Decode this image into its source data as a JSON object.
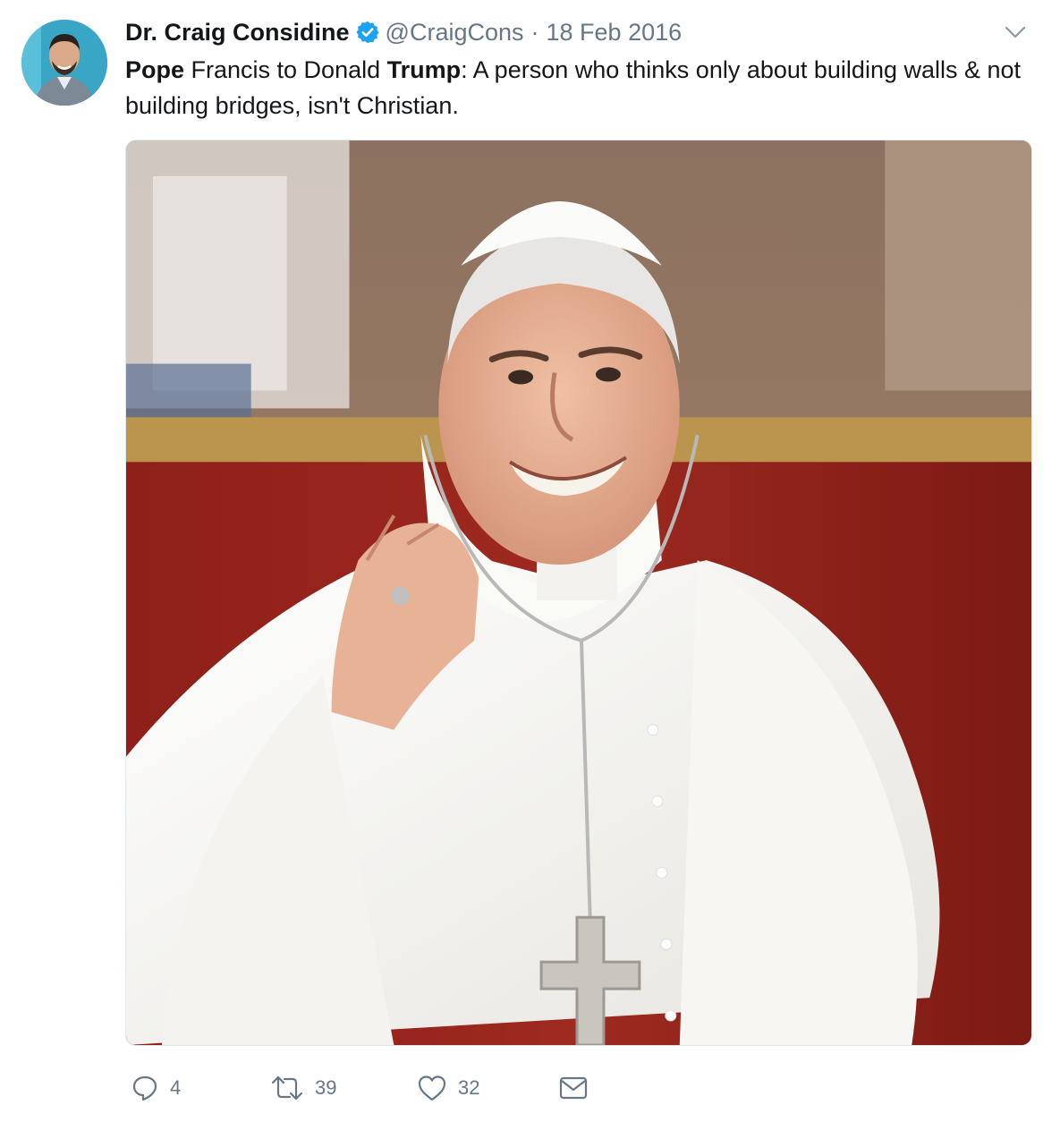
{
  "tweet": {
    "display_name": "Dr. Craig Considine",
    "handle": "@CraigCons",
    "separator": "·",
    "date": "18 Feb 2016",
    "text": {
      "part1_bold": "Pope",
      "part2": " Francis to Donald ",
      "part3_bold": "Trump",
      "part4": ": A person who thinks only about building walls & not building bridges, isn't Christian."
    },
    "actions": {
      "replies": "4",
      "retweets": "39",
      "likes": "32"
    }
  },
  "icons": {
    "verified": "verified-badge-icon",
    "caret": "chevron-down-icon",
    "reply": "reply-icon",
    "retweet": "retweet-icon",
    "like": "heart-icon",
    "dm": "envelope-icon"
  },
  "colors": {
    "verified_blue": "#1da1f2",
    "secondary_text": "#657786",
    "primary_text": "#14171a"
  }
}
